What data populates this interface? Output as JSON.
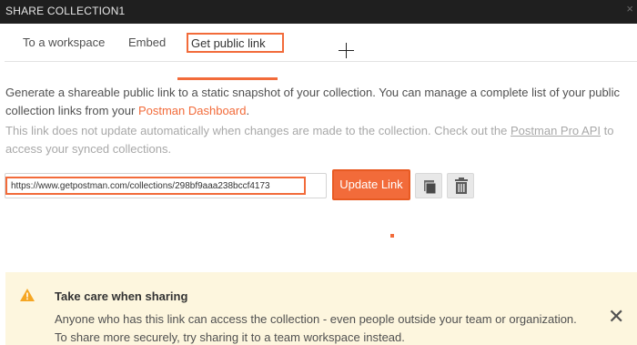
{
  "window": {
    "title": "SHARE COLLECTION1",
    "close_glyph": "×"
  },
  "tabs": [
    {
      "label": "To a workspace"
    },
    {
      "label": "Embed"
    },
    {
      "label": "Get public link",
      "active": true
    }
  ],
  "description": {
    "text_before": "Generate a shareable public link to a static snapshot of your collection. You can manage a complete list of your public collection links from your ",
    "dashboard_link": "Postman Dashboard",
    "text_after": "."
  },
  "note": {
    "text_before": "This link does not update automatically when changes are made to the collection. Check out the ",
    "api_link": "Postman Pro API",
    "text_after": " to access your synced collections."
  },
  "link": {
    "url": "https://www.getpostman.com/collections/298bf9aaa238bccf4173",
    "update_label": "Update Link"
  },
  "icons": {
    "copy": "copy-icon",
    "delete": "trash-icon",
    "warning": "warning-triangle-icon",
    "close": "close-icon"
  },
  "warning": {
    "title": "Take care when sharing",
    "body": "Anyone who has this link can access the collection - even people outside your team or organization. To share more securely, try sharing it to a team workspace instead.",
    "close_glyph": "✕"
  },
  "colors": {
    "accent": "#f26b3a",
    "titlebar": "#1f1f1f",
    "warning_bg": "#fdf6de",
    "warning_icon": "#f5a623"
  }
}
